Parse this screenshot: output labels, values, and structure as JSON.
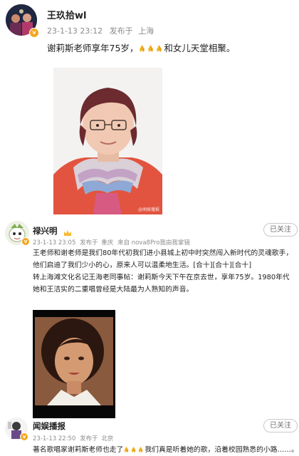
{
  "post": {
    "author": "王玖拾wl",
    "time": "23-1-13 23:12",
    "published_label": "发布于",
    "location": "上海",
    "text_before_emoji": "谢莉斯老师享年75岁，",
    "text_after_emoji": "和女儿天堂相聚。",
    "emoji_name": "pray-emoji",
    "emoji_count": 3,
    "image_watermark": "@闻娱播报"
  },
  "comments": [
    {
      "author": "禄兴明",
      "time": "23-1-13 23:05",
      "published_label": "发布于",
      "location": "重庆",
      "device": "来自 nova8Pro我由我掌镜",
      "follow_label": "已关注",
      "paragraph_1": "王老师和谢老师是我们80年代初我们进小县城上初中时突然闯入新时代的灵魂歌手，他们启迪了我们少小的心，原来人可以温柔地生活。[合十][合十][合十]",
      "paragraph_2": "转上海滩文化名记王海老同事帖：谢莉斯今天下午在京去世，享年75岁。1980年代她和王洁实的二重唱曾经是大陆最为人熟知的声音。"
    },
    {
      "author": "闻娱播报",
      "time": "23-1-13 22:50",
      "published_label": "发布于",
      "location": "北京",
      "follow_label": "已关注",
      "text_before_emoji": "著名歌唱家谢莉斯老师也走了",
      "text_after_emoji": "我们真是听着她的歌，沿着校园熟悉的小路……。"
    }
  ],
  "colors": {
    "badge": "#f5a623",
    "meta_gray": "#8c8c8c",
    "follow_border": "#c8c8c8"
  }
}
